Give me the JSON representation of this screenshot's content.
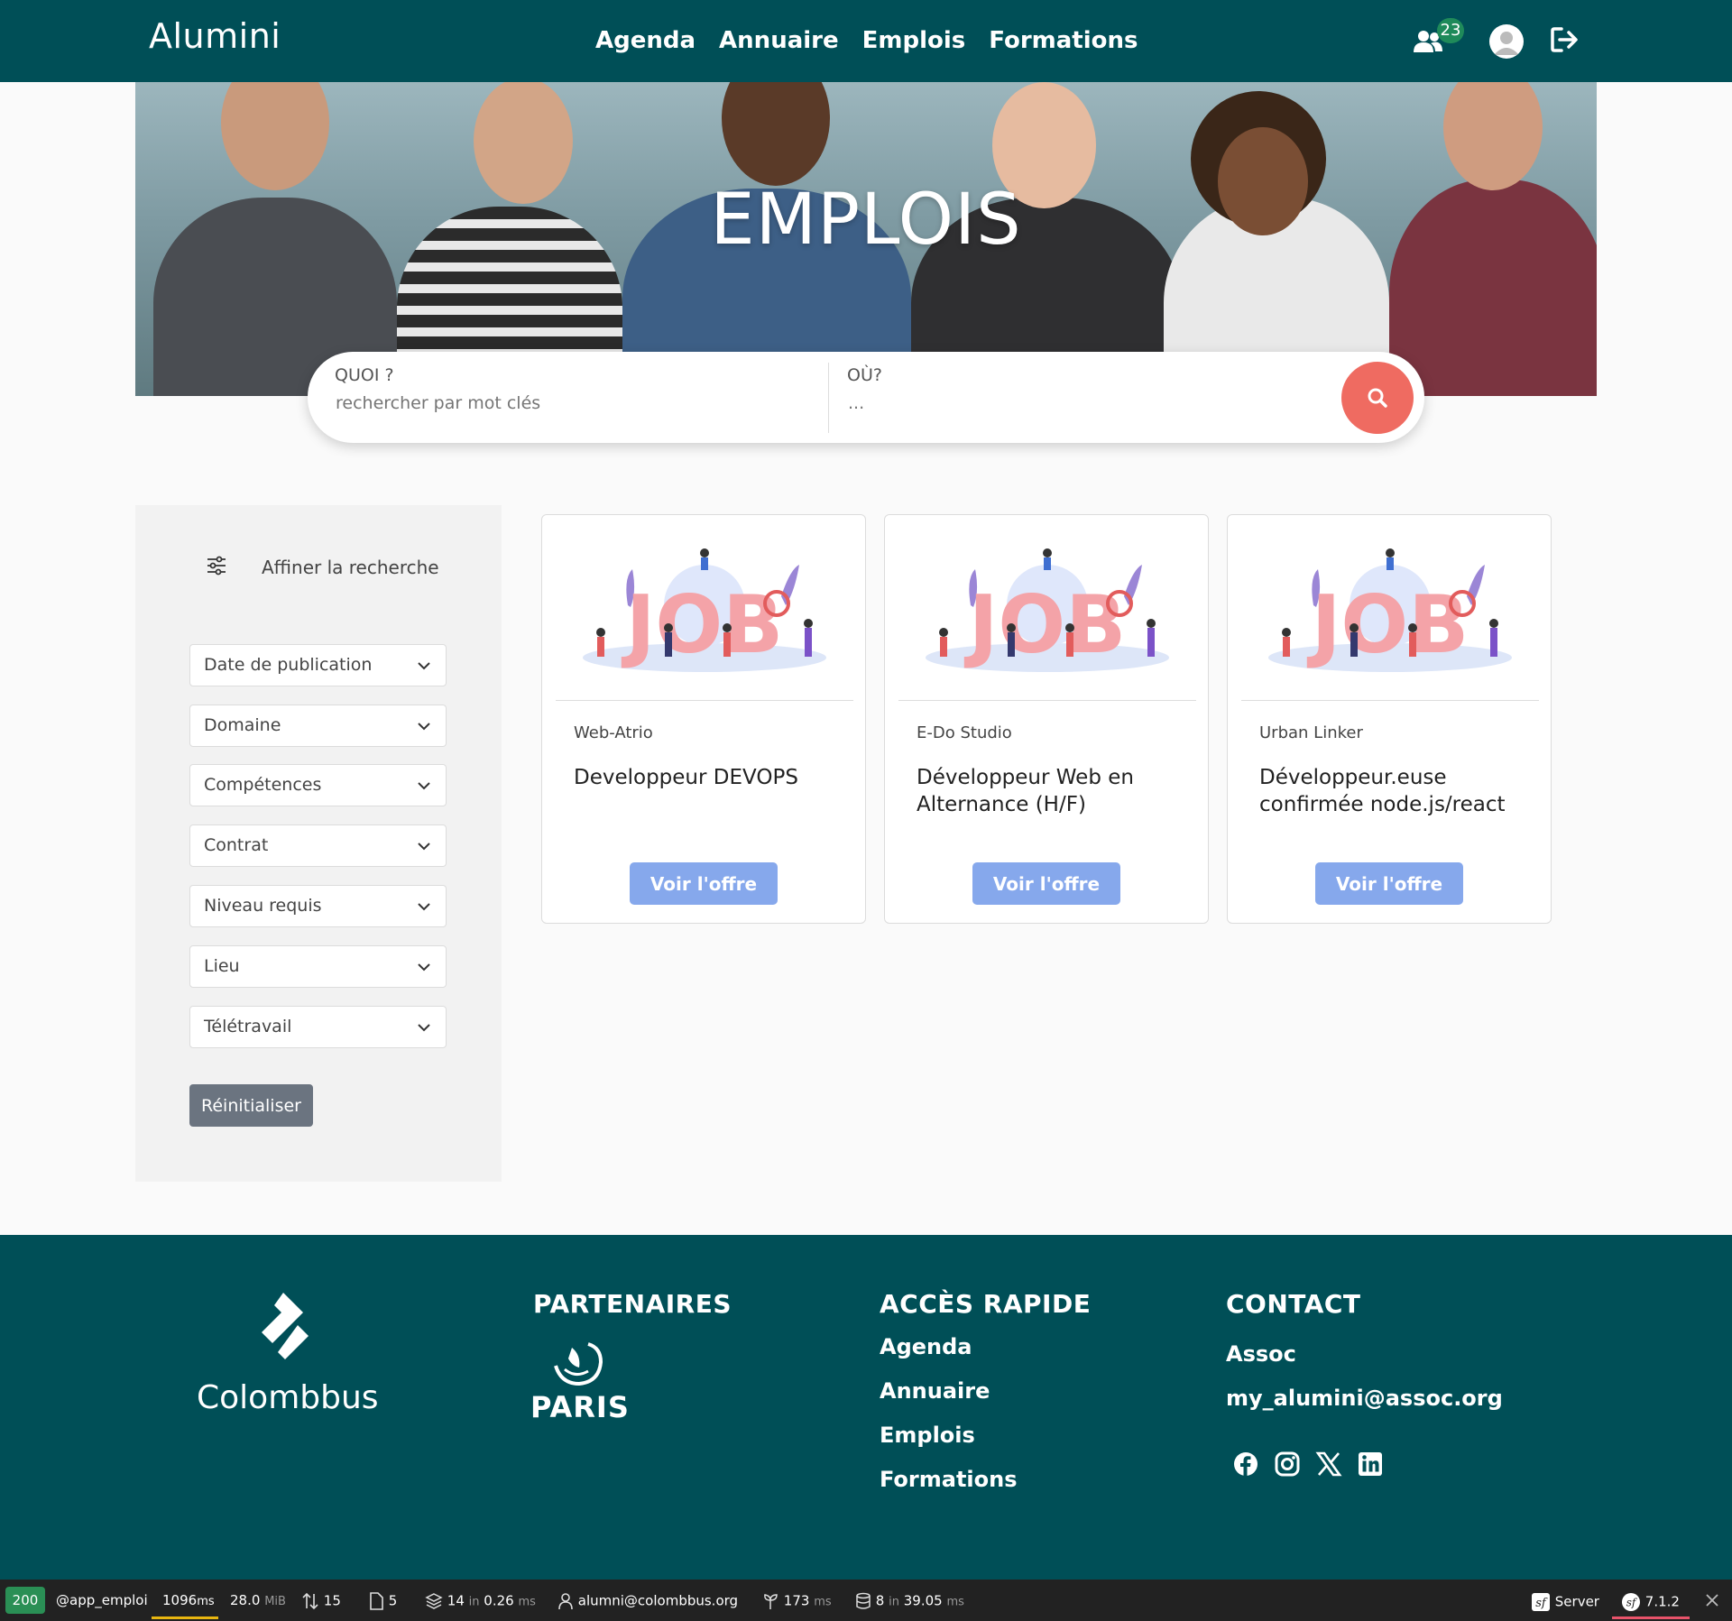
{
  "header": {
    "brand": "Alumini",
    "nav": [
      "Agenda",
      "Annuaire",
      "Emplois",
      "Formations"
    ],
    "notification_count": "23"
  },
  "hero": {
    "title": "EMPLOIS"
  },
  "search": {
    "what_label": "QUOI ?",
    "what_placeholder": "rechercher par mot clés",
    "where_label": "OÙ?",
    "where_placeholder": "..."
  },
  "filters": {
    "heading": "Affiner la recherche",
    "selects": [
      "Date de publication",
      "Domaine",
      "Compétences",
      "Contrat",
      "Niveau requis",
      "Lieu",
      "Télétravail"
    ],
    "reset_label": "Réinitialiser"
  },
  "jobs": [
    {
      "company": "Web-Atrio",
      "title": "Developpeur DEVOPS",
      "button": "Voir l'offre",
      "illustration_text": "JOB"
    },
    {
      "company": "E-Do Studio",
      "title": "Développeur Web en Alternance (H/F)",
      "button": "Voir l'offre",
      "illustration_text": "JOB"
    },
    {
      "company": "Urban Linker",
      "title": "Développeur.euse confirmée node.js/react",
      "button": "Voir l'offre",
      "illustration_text": "JOB"
    }
  ],
  "footer": {
    "logo_text": "Colombbus",
    "partners_heading": "PARTENAIRES",
    "partner_logo_text": "PARIS",
    "quick_heading": "ACCÈS RAPIDE",
    "quick_links": [
      "Agenda",
      "Annuaire",
      "Emplois",
      "Formations"
    ],
    "contact_heading": "CONTACT",
    "contact_name": "Assoc",
    "contact_email": "my_alumini@assoc.org",
    "social_icons": [
      "facebook-icon",
      "instagram-icon",
      "x-icon",
      "linkedin-icon"
    ]
  },
  "debug_bar": {
    "status": "200",
    "route": "@app_emploi",
    "time": "1096",
    "time_unit": "ms",
    "memory": "28.0",
    "memory_unit": "MiB",
    "requests": "15",
    "files": "5",
    "cache_calls": "14",
    "cache_in": "in",
    "cache_time": "0.26",
    "cache_unit": "ms",
    "user": "alumni@colombbus.org",
    "twig_time": "173",
    "twig_unit": "ms",
    "db_queries": "8",
    "db_in": "in",
    "db_time": "39.05",
    "db_unit": "ms",
    "server_label": "Server",
    "version": "7.1.2"
  },
  "colors": {
    "primary": "#004f57",
    "accent_red": "#ef6b61",
    "button_blue": "#86a8ec",
    "badge_green": "#1f8a5a"
  }
}
